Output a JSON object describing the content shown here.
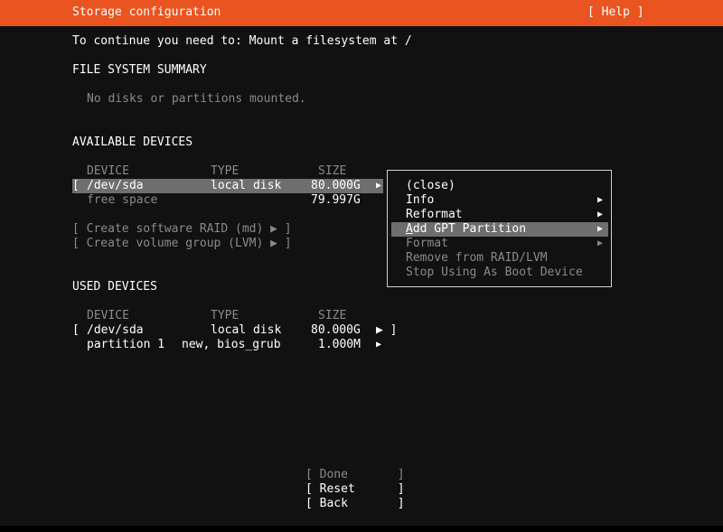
{
  "header": {
    "title": "Storage configuration",
    "help": "[ Help ]"
  },
  "instruction": "To continue you need to: Mount a filesystem at /",
  "fs_summary": {
    "heading": "FILE SYSTEM SUMMARY",
    "empty_text": "No disks or partitions mounted."
  },
  "available": {
    "heading": "AVAILABLE DEVICES",
    "col_device": "DEVICE",
    "col_type": "TYPE",
    "col_size": "SIZE",
    "rows": [
      {
        "bracket": "[",
        "device": "/dev/sda",
        "type": "local disk",
        "size": "80.000G",
        "arrow": "▶"
      },
      {
        "device": "free space",
        "type": "",
        "size": "79.997G"
      }
    ],
    "create_raid": "[ Create software RAID (md) ▶ ]",
    "create_lvm": "[ Create volume group (LVM) ▶ ]"
  },
  "used": {
    "heading": "USED DEVICES",
    "col_device": "DEVICE",
    "col_type": "TYPE",
    "col_size": "SIZE",
    "rows": [
      {
        "bracket": "[",
        "device": "/dev/sda",
        "type": "local disk",
        "size": "80.000G",
        "arrow": "▶ ]"
      },
      {
        "device": "partition 1",
        "type": "new, bios_grub",
        "size": "1.000M",
        "arrow": "▶"
      }
    ]
  },
  "menu": {
    "open_arrow": "◀",
    "items": [
      {
        "label": "(close)",
        "arrow": ""
      },
      {
        "label": "Info",
        "arrow": "▶"
      },
      {
        "label": "Reformat",
        "arrow": "▶"
      },
      {
        "label_first": "A",
        "label_rest": "dd GPT Partition",
        "arrow": "▶"
      },
      {
        "label": "Format",
        "arrow": "▶"
      },
      {
        "label": "Remove from RAID/LVM",
        "arrow": ""
      },
      {
        "label": "Stop Using As Boot Device",
        "arrow": ""
      }
    ]
  },
  "buttons": {
    "done": "[ Done       ]",
    "reset": "[ Reset      ]",
    "back": "[ Back       ]"
  }
}
